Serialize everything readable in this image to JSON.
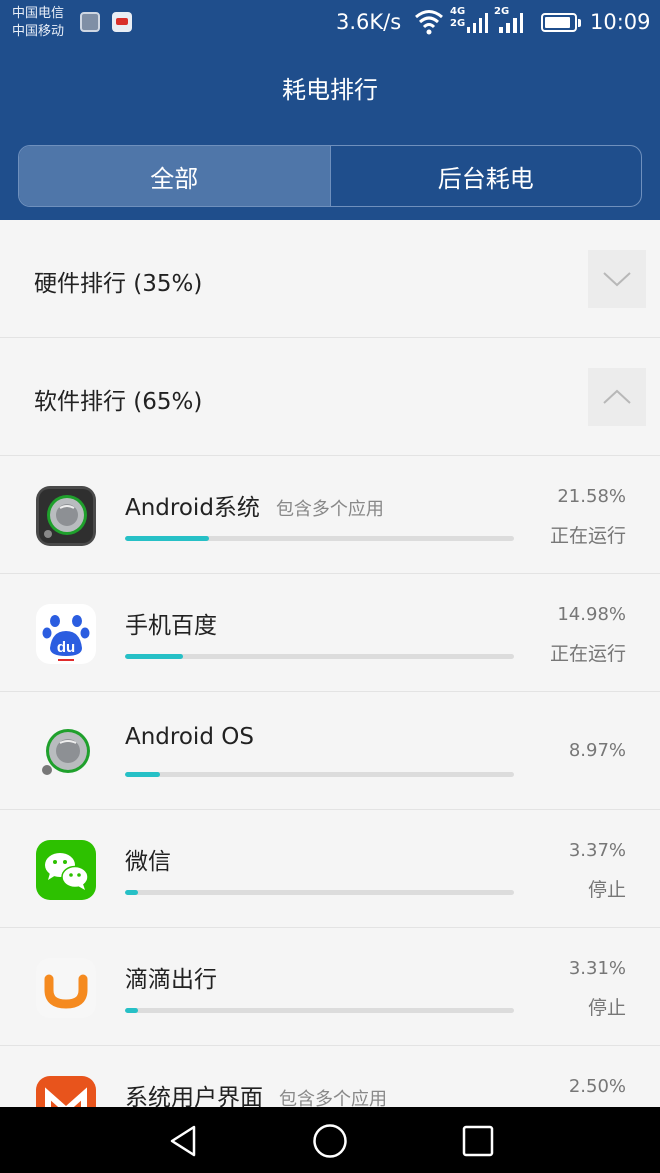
{
  "status_bar": {
    "carrier_1": "中国电信",
    "carrier_2": "中国移动",
    "net_speed": "3.6K/s",
    "net_type_1": "4G",
    "net_type_2": "2G",
    "net_type_3": "2G",
    "time": "10:09",
    "icons": [
      "gallery-notification-icon",
      "app-notification-icon",
      "wifi-icon",
      "signal-icon",
      "battery-icon"
    ]
  },
  "header": {
    "title": "耗电排行",
    "tabs": [
      {
        "label": "全部",
        "active": true
      },
      {
        "label": "后台耗电",
        "active": false
      }
    ]
  },
  "sections": [
    {
      "label": "硬件排行 (35%)",
      "expanded": false
    },
    {
      "label": "软件排行 (65%)",
      "expanded": true
    }
  ],
  "apps": [
    {
      "name": "Android系统",
      "sub": "包含多个应用",
      "percent": "21.58%",
      "fraction": 0.2158,
      "state": "正在运行",
      "icon": "android-system-icon"
    },
    {
      "name": "手机百度",
      "sub": "",
      "percent": "14.98%",
      "fraction": 0.1498,
      "state": "正在运行",
      "icon": "baidu-icon"
    },
    {
      "name": "Android OS",
      "sub": "",
      "percent": "8.97%",
      "fraction": 0.0897,
      "state": "",
      "icon": "android-os-icon"
    },
    {
      "name": "微信",
      "sub": "",
      "percent": "3.37%",
      "fraction": 0.0337,
      "state": "停止",
      "icon": "wechat-icon"
    },
    {
      "name": "滴滴出行",
      "sub": "",
      "percent": "3.31%",
      "fraction": 0.0331,
      "state": "停止",
      "icon": "didi-icon"
    },
    {
      "name": "系统用户界面",
      "sub": "包含多个应用",
      "percent": "2.50%",
      "fraction": 0.025,
      "state": "",
      "icon": "system-ui-icon"
    }
  ],
  "colors": {
    "header_bg": "#1f4e8c",
    "active_tab_bg": "#4f76a9",
    "bar_fill": "#26c0c6",
    "bar_track": "#dcdcdc"
  },
  "navbar": {
    "buttons": [
      "back-icon",
      "home-icon",
      "recents-icon"
    ]
  }
}
